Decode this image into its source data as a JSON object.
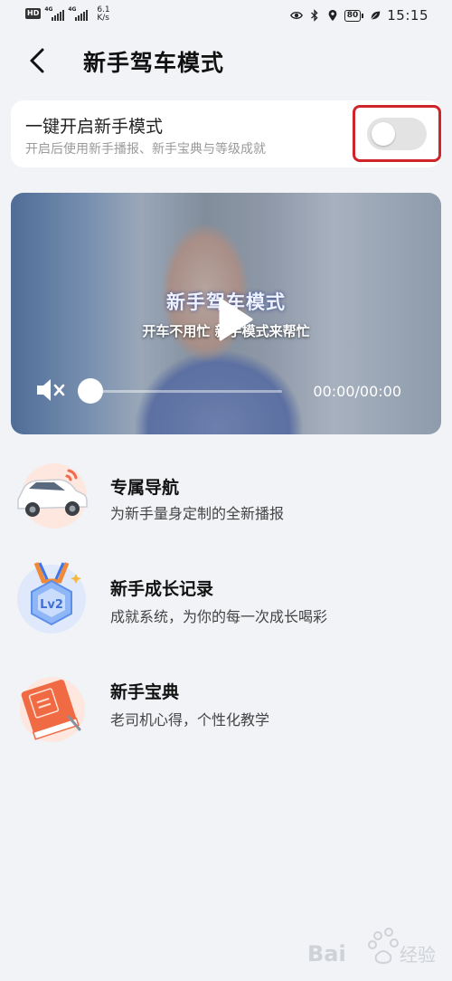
{
  "status_bar": {
    "hd_badge": "HD",
    "sim1_tag": "4G",
    "sim2_tag": "4G",
    "speed_value": "6.1",
    "speed_unit": "K/s",
    "battery": "80",
    "time": "15:15"
  },
  "header": {
    "title": "新手驾车模式"
  },
  "toggle_card": {
    "title": "一键开启新手模式",
    "description": "开启后使用新手播报、新手宝典与等级成就",
    "enabled": false
  },
  "video": {
    "title": "新手驾车模式",
    "subtitle": "开车不用忙 新手模式来帮忙",
    "time_display": "00:00/00:00",
    "muted": true,
    "progress": 0
  },
  "features": [
    {
      "title": "专属导航",
      "description": "为新手量身定制的全新播报",
      "icon": "car-icon"
    },
    {
      "title": "新手成长记录",
      "description": "成就系统，为你的每一次成长喝彩",
      "icon": "lv2-badge-icon"
    },
    {
      "title": "新手宝典",
      "description": "老司机心得，个性化教学",
      "icon": "handbook-icon"
    }
  ],
  "watermark": {
    "text": "Bai 经验"
  },
  "colors": {
    "background": "#f1f3f6",
    "card": "#ffffff",
    "highlight_border": "#d0242b",
    "switch_off": "#e3e3e3"
  }
}
